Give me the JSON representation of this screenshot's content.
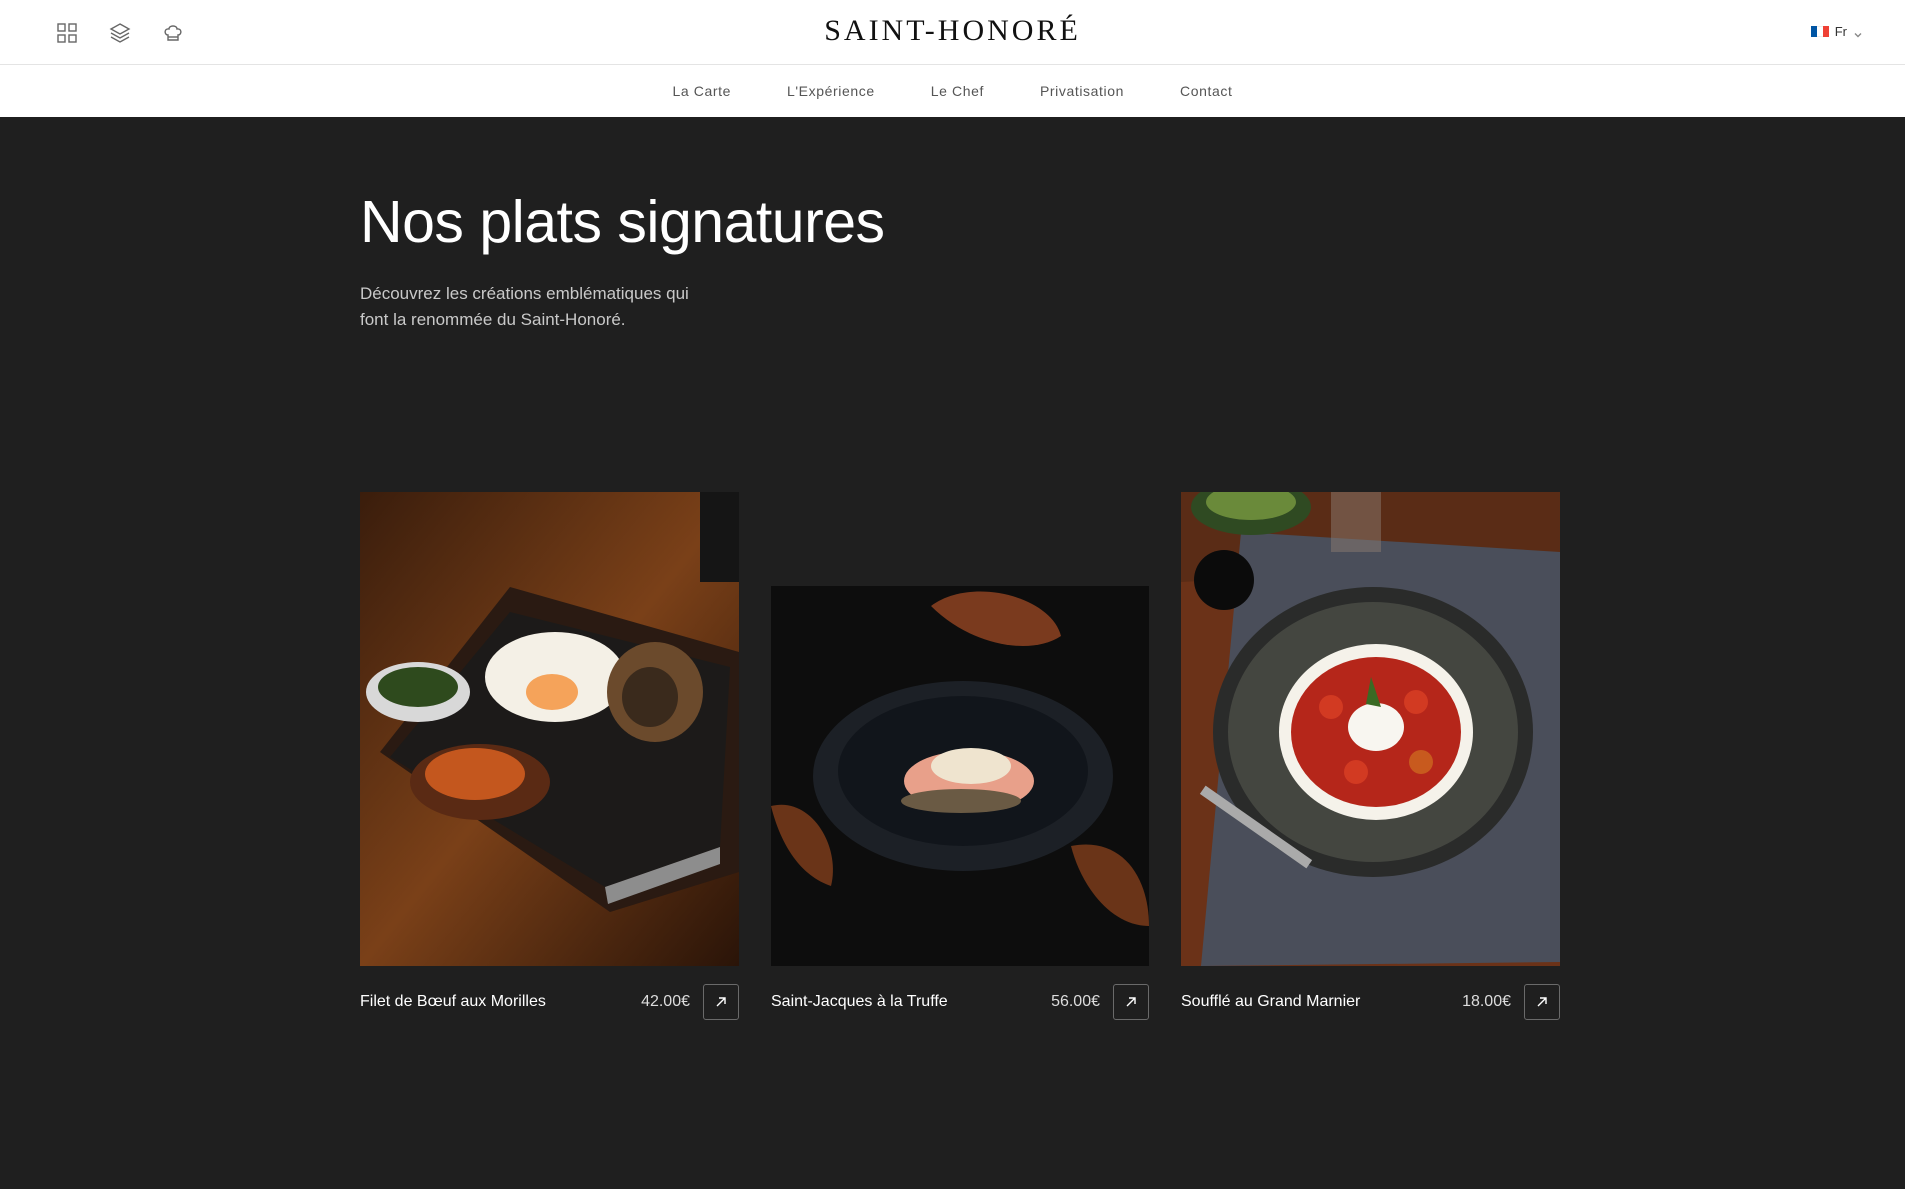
{
  "header": {
    "brand": "SAINT-HONORÉ",
    "icons": [
      "grid-icon",
      "layers-icon",
      "chef-hat-icon"
    ],
    "language": {
      "label": "Fr",
      "flag_colors": [
        "#0055a4",
        "#ffffff",
        "#ef4135"
      ]
    }
  },
  "nav": {
    "items": [
      {
        "label": "La Carte"
      },
      {
        "label": "L'Expérience"
      },
      {
        "label": "Le Chef"
      },
      {
        "label": "Privatisation"
      },
      {
        "label": "Contact"
      }
    ]
  },
  "hero": {
    "title": "Nos plats signatures",
    "subtitle": "Découvrez les créations emblématiques qui font la renommée du Saint-Honoré."
  },
  "dishes": [
    {
      "name": "Filet de Bœuf aux Morilles",
      "price": "42.00€",
      "image": "steak-plate-photo"
    },
    {
      "name": "Saint-Jacques à la Truffe",
      "price": "56.00€",
      "image": "scallop-plate-photo"
    },
    {
      "name": "Soufflé au Grand Marnier",
      "price": "18.00€",
      "image": "tomato-burrata-photo"
    }
  ],
  "colors": {
    "page_bg": "#1f1f1f",
    "header_bg": "#ffffff"
  }
}
